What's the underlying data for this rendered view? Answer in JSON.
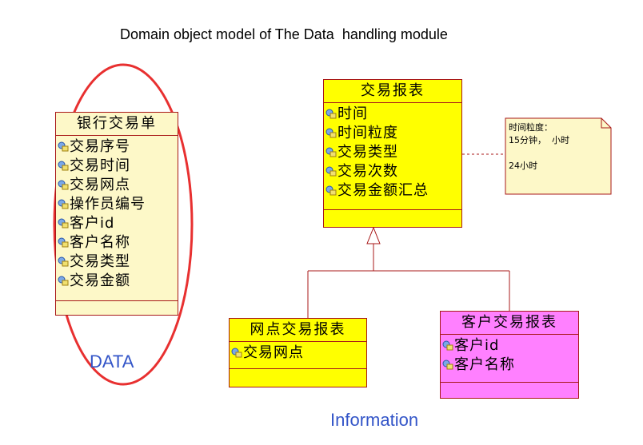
{
  "title": "Domain object model of The Data  handling module",
  "colors": {
    "border": "#a81818",
    "light_yellow": "#fdf8c8",
    "yellow": "#ffff00",
    "magenta": "#ff80ff",
    "ellipse": "#e83030",
    "label_blue": "#3355c8"
  },
  "classes": {
    "bank_transaction": {
      "name": "银行交易单",
      "attrs": [
        "交易序号",
        "交易时间",
        "交易网点",
        "操作员编号",
        "客户id",
        "客户名称",
        "交易类型",
        "交易金额"
      ]
    },
    "transaction_report": {
      "name": "交易报表",
      "attrs": [
        "时间",
        "时间粒度",
        "交易类型",
        "交易次数",
        "交易金额汇总"
      ]
    },
    "branch_report": {
      "name": "网点交易报表",
      "attrs": [
        "交易网点"
      ]
    },
    "customer_report": {
      "name": "客户交易报表",
      "attrs": [
        "客户id",
        "客户名称"
      ]
    }
  },
  "note": {
    "text": "时间粒度：\n15分钟，  小时\n\n24小时"
  },
  "labels": {
    "data": "DATA",
    "information": "Information"
  },
  "icon_names": {
    "attribute": "attribute-icon"
  }
}
